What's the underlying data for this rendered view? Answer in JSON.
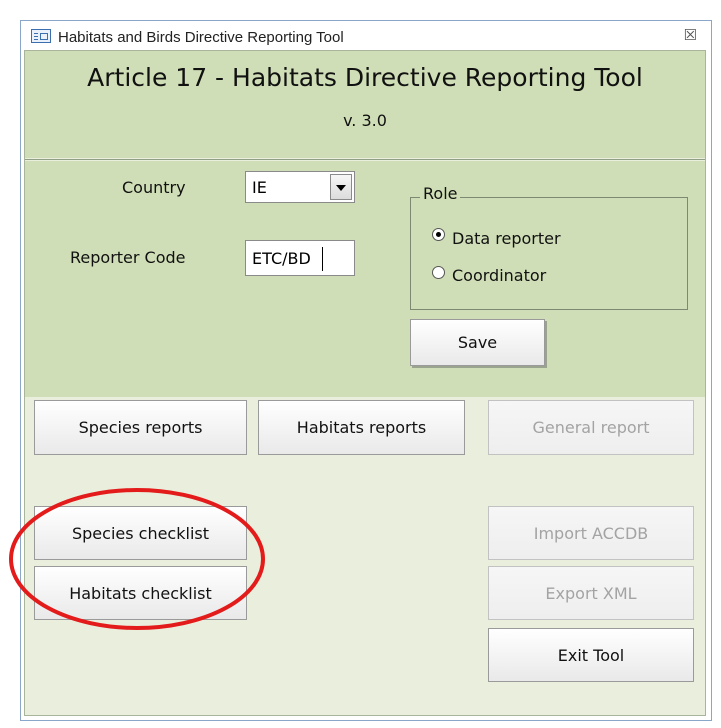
{
  "window": {
    "title": "Habitats and Birds Directive Reporting Tool",
    "close_symbol": "☒"
  },
  "header": {
    "title": "Article 17 - Habitats Directive Reporting Tool",
    "version": "v. 3.0"
  },
  "form": {
    "country_label": "Country",
    "country_value": "IE",
    "reporter_code_label": "Reporter Code",
    "reporter_code_value": "ETC/BD",
    "role": {
      "legend": "Role",
      "options": [
        {
          "label": "Data reporter",
          "checked": true
        },
        {
          "label": "Coordinator",
          "checked": false
        }
      ]
    },
    "save_label": "Save"
  },
  "buttons": {
    "species_reports": "Species reports",
    "habitats_reports": "Habitats reports",
    "general_report": "General report",
    "species_checklist": "Species checklist",
    "habitats_checklist": "Habitats checklist",
    "import_accdb": "Import ACCDB",
    "export_xml": "Export XML",
    "exit_tool": "Exit Tool"
  },
  "colors": {
    "band_green": "#cfdeb6",
    "body_green": "#e9efdc",
    "annotation_red": "#e31b1b"
  }
}
